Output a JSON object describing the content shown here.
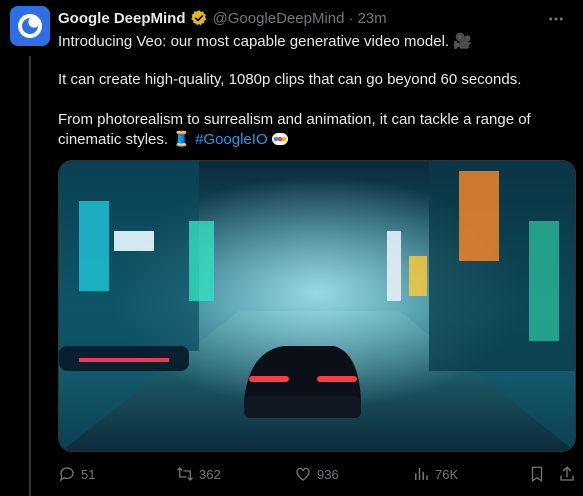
{
  "tweet": {
    "author_name": "Google DeepMind",
    "handle": "@GoogleDeepMind",
    "separator": "·",
    "time": "23m",
    "line1": "Introducing Veo: our most capable generative video model. 🎥",
    "line2": "It can create high-quality, 1080p clips that can go beyond 60 seconds.",
    "line3": "From photorealism to surrealism and animation, it can tackle a range of cinematic styles. 🧵",
    "hashtag": "#GoogleIO"
  },
  "actions": {
    "replies": "51",
    "reposts": "362",
    "likes": "936",
    "views": "76K"
  },
  "colors": {
    "background": "#000000",
    "text": "#e7e9ea",
    "muted": "#71767b",
    "link": "#1d9bf0",
    "badge": "#e2b719",
    "avatar": "#2f6fe4"
  },
  "icons": [
    "verified-badge-icon",
    "more-icon",
    "reply-icon",
    "repost-icon",
    "like-icon",
    "views-icon",
    "bookmark-icon",
    "share-icon"
  ]
}
